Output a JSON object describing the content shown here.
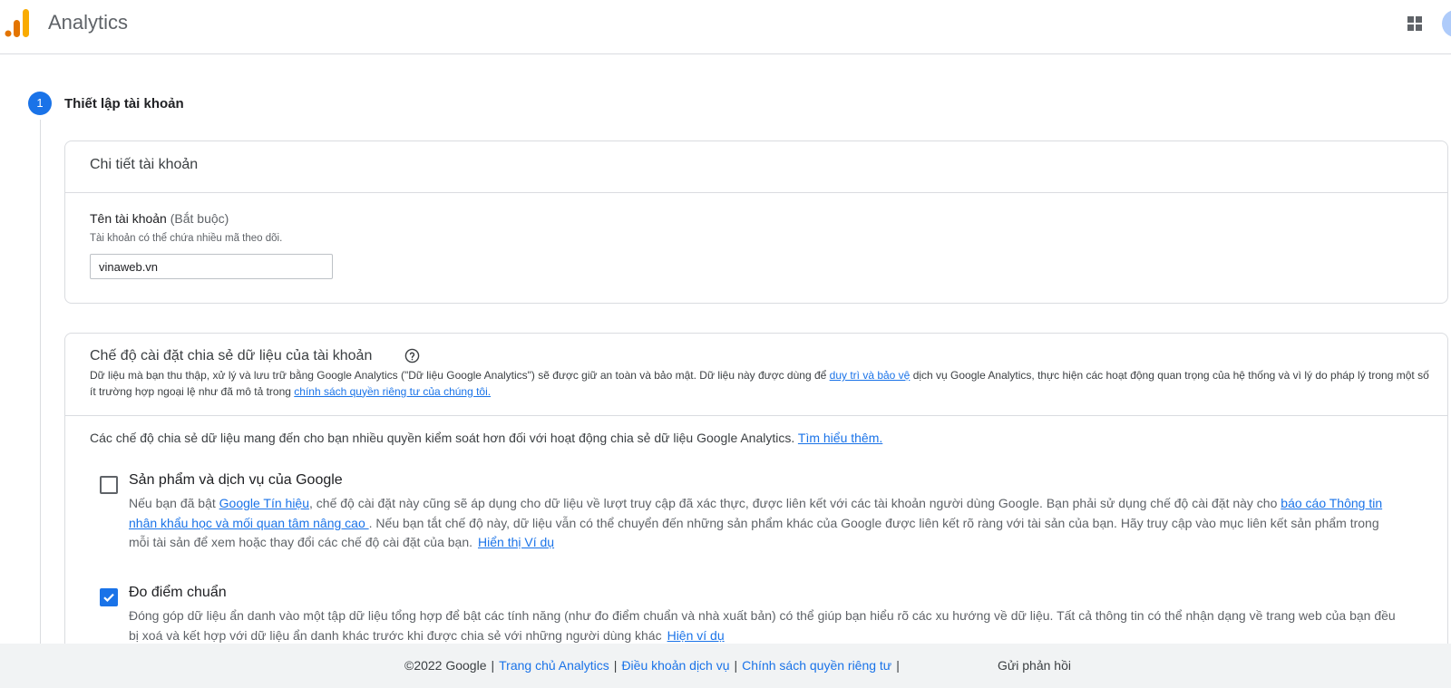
{
  "header": {
    "app_title": "Analytics",
    "logo_icon": "analytics-bars-logo",
    "apps_icon": "apps-grid-icon",
    "brand_colors": {
      "logo_orange": "#f9ab00",
      "logo_dark_orange": "#e37400"
    }
  },
  "stepper": {
    "step_number": "1",
    "step_title": "Thiết lập tài khoản",
    "accent": "#1a73e8"
  },
  "account_details": {
    "card_title": "Chi tiết tài khoản",
    "field_label": "Tên tài khoản",
    "field_required": "(Bắt buộc)",
    "field_help": "Tài khoản có thể chứa nhiều mã theo dõi.",
    "field_value": "vinaweb.vn"
  },
  "data_sharing": {
    "card_title": "Chế độ cài đặt chia sẻ dữ liệu của tài khoản",
    "help_icon": "help-circle-icon",
    "desc_part1": "Dữ liệu mà bạn thu thập, xử lý và lưu trữ bằng Google Analytics (\"Dữ liệu Google Analytics\") sẽ được giữ an toàn và bảo mật. Dữ liệu này được dùng để ",
    "desc_link1": "duy trì và bảo vệ",
    "desc_part2": " dịch vụ Google Analytics, thực hiện các hoạt động quan trọng của hệ thống và vì lý do pháp lý trong một số ít trường hợp ngoại lệ như đã mô tả trong ",
    "desc_link2": "chính sách quyền riêng tư của chúng tôi.",
    "intro_text": "Các chế độ chia sẻ dữ liệu mang đến cho bạn nhiều quyền kiểm soát hơn đối với hoạt động chia sẻ dữ liệu Google Analytics.",
    "intro_link": "Tìm hiểu thêm.",
    "options": [
      {
        "title": "Sản phẩm và dịch vụ của Google",
        "checked": false,
        "desc_part1": "Nếu bạn đã bật ",
        "desc_link1": "Google Tín hiệu",
        "desc_part2": ", chế độ cài đặt này cũng sẽ áp dụng cho dữ liệu về lượt truy cập đã xác thực, được liên kết với các tài khoản người dùng Google. Bạn phải sử dụng chế độ cài đặt này cho ",
        "desc_link2": "báo cáo Thông tin nhân khẩu học và mối quan tâm nâng cao ",
        "desc_part3": ". Nếu bạn tắt chế độ này, dữ liệu vẫn có thể chuyển đến những sản phẩm khác của Google được liên kết rõ ràng với tài sản của bạn. Hãy truy cập vào mục liên kết sản phẩm trong mỗi tài sản để xem hoặc thay đổi các chế độ cài đặt của bạn.",
        "desc_link3": "Hiển thị Ví dụ"
      },
      {
        "title": "Đo điểm chuẩn",
        "checked": true,
        "desc_part1": "Đóng góp dữ liệu ẩn danh vào một tập dữ liệu tổng hợp để bật các tính năng (như đo điểm chuẩn và nhà xuất bản) có thể giúp bạn hiểu rõ các xu hướng về dữ liệu. Tất cả thông tin có thể nhận dạng về trang web của bạn đều bị xoá và kết hợp với dữ liệu ẩn danh khác trước khi được chia sẻ với những người dùng khác",
        "desc_link1": "Hiện ví dụ"
      }
    ]
  },
  "footer": {
    "copyright": "©2022 Google",
    "link_home": "Trang chủ Analytics",
    "link_terms": "Điều khoản dịch vụ",
    "link_privacy": "Chính sách quyền riêng tư",
    "feedback": "Gửi phản hồi"
  }
}
